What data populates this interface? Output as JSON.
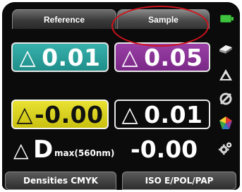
{
  "tabs": {
    "reference": "Reference",
    "sample": "Sample"
  },
  "delta_boxes": {
    "cyan": {
      "symbol": "△",
      "value": "0.01"
    },
    "magenta": {
      "symbol": "△",
      "value": "0.05"
    },
    "yellow": {
      "symbol": "△",
      "value": "-0.00"
    },
    "black": {
      "symbol": "△",
      "value": "0.01"
    }
  },
  "dmax": {
    "symbol": "△",
    "letter": "D",
    "subscript": "max(560nm)",
    "value": "-0.00"
  },
  "bottom": {
    "left_button": "Densities CMYK",
    "right_button": "ISO E/POL/PAP"
  },
  "colors": {
    "cyan": "#1f8f8a",
    "magenta": "#7a2887",
    "yellow": "#e2d81c",
    "black": "#0b0b0b",
    "highlight": "#d0121b",
    "battery": "#3ec43e"
  },
  "icons": [
    "battery-icon",
    "paper-icon",
    "delta-icon",
    "no-filter-icon",
    "color-wheel-icon",
    "settings-gear-icon"
  ]
}
